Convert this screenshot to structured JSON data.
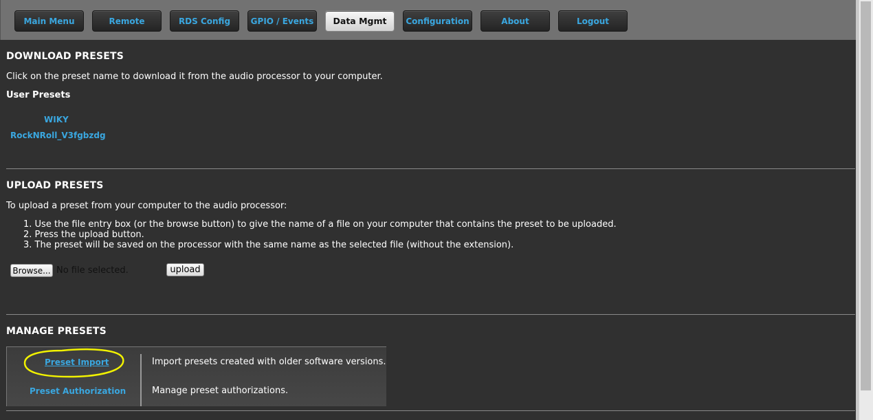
{
  "nav": {
    "items": [
      {
        "label": "Main Menu"
      },
      {
        "label": "Remote"
      },
      {
        "label": "RDS Config"
      },
      {
        "label": "GPIO / Events"
      },
      {
        "label": "Data Mgmt",
        "active": true
      },
      {
        "label": "Configuration"
      },
      {
        "label": "About"
      },
      {
        "label": "Logout"
      }
    ]
  },
  "download": {
    "title": "DOWNLOAD PRESETS",
    "description": "Click on the preset name to download it from the audio processor to your computer.",
    "user_presets_label": "User Presets",
    "presets": [
      "WIKY",
      "RockNRoll_V3fgbzdg"
    ]
  },
  "upload": {
    "title": "UPLOAD PRESETS",
    "intro": "To upload a preset from your computer to the audio processor:",
    "steps": [
      "1. Use the file entry box (or the browse button) to give the name of a file on your computer that contains the preset to be uploaded.",
      "2. Press the upload button.",
      "3. The preset will be saved on the processor with the same name as the selected file (without the extension)."
    ],
    "browse_label": "Browse...",
    "file_status": "No file selected.",
    "upload_label": "upload"
  },
  "manage": {
    "title": "MANAGE PRESETS",
    "rows": [
      {
        "link": "Preset Import",
        "description": "Import presets created with older software versions."
      },
      {
        "link": "Preset Authorization",
        "description": "Manage preset authorizations."
      }
    ]
  },
  "colors": {
    "accent": "#3aa7e0",
    "background": "#303030",
    "highlight_circle": "#f2f200"
  }
}
